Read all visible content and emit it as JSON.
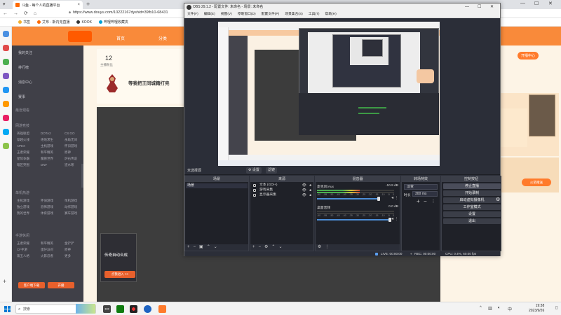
{
  "browser": {
    "tab_title": "斗鱼 - 每个人的直播平台",
    "new_tab": "+",
    "url": "https://www.douyu.com/10222167dyshid=39fb10-68431",
    "bookmarks": [
      "书签",
      "艾布 - 斯内克直播",
      "KOOK",
      "哔哩哔哩收藏夹"
    ],
    "win_min": "—",
    "win_max": "☐",
    "win_close": "✕"
  },
  "douyu": {
    "nav": [
      "首页",
      "分类",
      "赛事"
    ],
    "sidebar_items": [
      "我的关注",
      "排行榜",
      "消息中心",
      "赛事"
    ],
    "sidebar_heads": [
      "最近观看",
      "网游竞技",
      "单机热游",
      "手游休闲"
    ],
    "grid_items": [
      "英雄联盟",
      "DOTA2",
      "CS:GO",
      "穿越火线",
      "绝地求生",
      "永劫无间",
      "APEX",
      "主机游戏",
      "怀旧游戏",
      "王者荣耀",
      "和平精英",
      "原神",
      "星际争霸",
      "魔兽世界",
      "炉石传说",
      "暗区突围",
      "DNF",
      "逆水寒"
    ],
    "grid_items_2": [
      "主机游戏",
      "怀旧游戏",
      "单机游戏",
      "独立游戏",
      "恐怖游戏",
      "动作游戏",
      "我的世界",
      "体育游戏",
      "赛车游戏"
    ],
    "grid_items_3": [
      "王者荣耀",
      "和平精英",
      "金铲铲",
      "CF手游",
      "蛋仔派对",
      "原神",
      "第五人格",
      "火影忍者",
      "更多"
    ],
    "stat_num": "12",
    "stat_label": "主播粉丝",
    "room_title": "等我把王同城籍打完",
    "ad_text": "传奇自动合成",
    "ad_button": "点我进入 >>",
    "bottom_btn_1": "客户端下载",
    "bottom_btn_2": "开播",
    "right_btn": "开播中心",
    "rocket_btn": "火箭赠送"
  },
  "obs": {
    "title": "OBS 29.1.2 - 配置文件: 未命名 - 场景: 未命名",
    "menu": [
      "文件(F)",
      "编辑(E)",
      "视图(V)",
      "停靠窗口(D)",
      "配置文件(P)",
      "场景集合(S)",
      "工具(T)",
      "帮助(H)"
    ],
    "dock_bar_label": "未选择源",
    "dock_bar_settings": "⚙ 设置",
    "dock_bar_filters": "滤镜",
    "scenes_title": "场景",
    "scene_item": "场景",
    "sources_title": "来源",
    "sources": [
      "文本 (GDI+)",
      "游戏采集",
      "显示器采集"
    ],
    "mixer_title": "混音器",
    "mixer": [
      {
        "name": "麦克风/Aux",
        "db": "-10.9 dB",
        "level": 0.55
      },
      {
        "name": "桌面音频",
        "db": "0.0 dB",
        "level": 0.0
      }
    ],
    "ticks": [
      "-60",
      "-55",
      "-50",
      "-45",
      "-40",
      "-35",
      "-30",
      "-25",
      "-20",
      "-15",
      "-10",
      "-5",
      "0"
    ],
    "transitions_title": "转场特效",
    "transition_type": "淡变",
    "duration_label": "时长",
    "duration_value": "300 ms",
    "controls_title": "控制按钮",
    "controls": [
      "停止直播",
      "开始录制",
      "启动虚拟摄像机",
      "工作室模式",
      "设置",
      "退出"
    ],
    "status_live": "LIVE: 00:00:00",
    "status_rec": "REC: 00:00:00",
    "status_cpu": "CPU: 0.4%, 60.00 fps"
  },
  "taskbar": {
    "search_placeholder": "搜索",
    "time": "19:38",
    "date": "2023/9/26",
    "lang": "中"
  }
}
